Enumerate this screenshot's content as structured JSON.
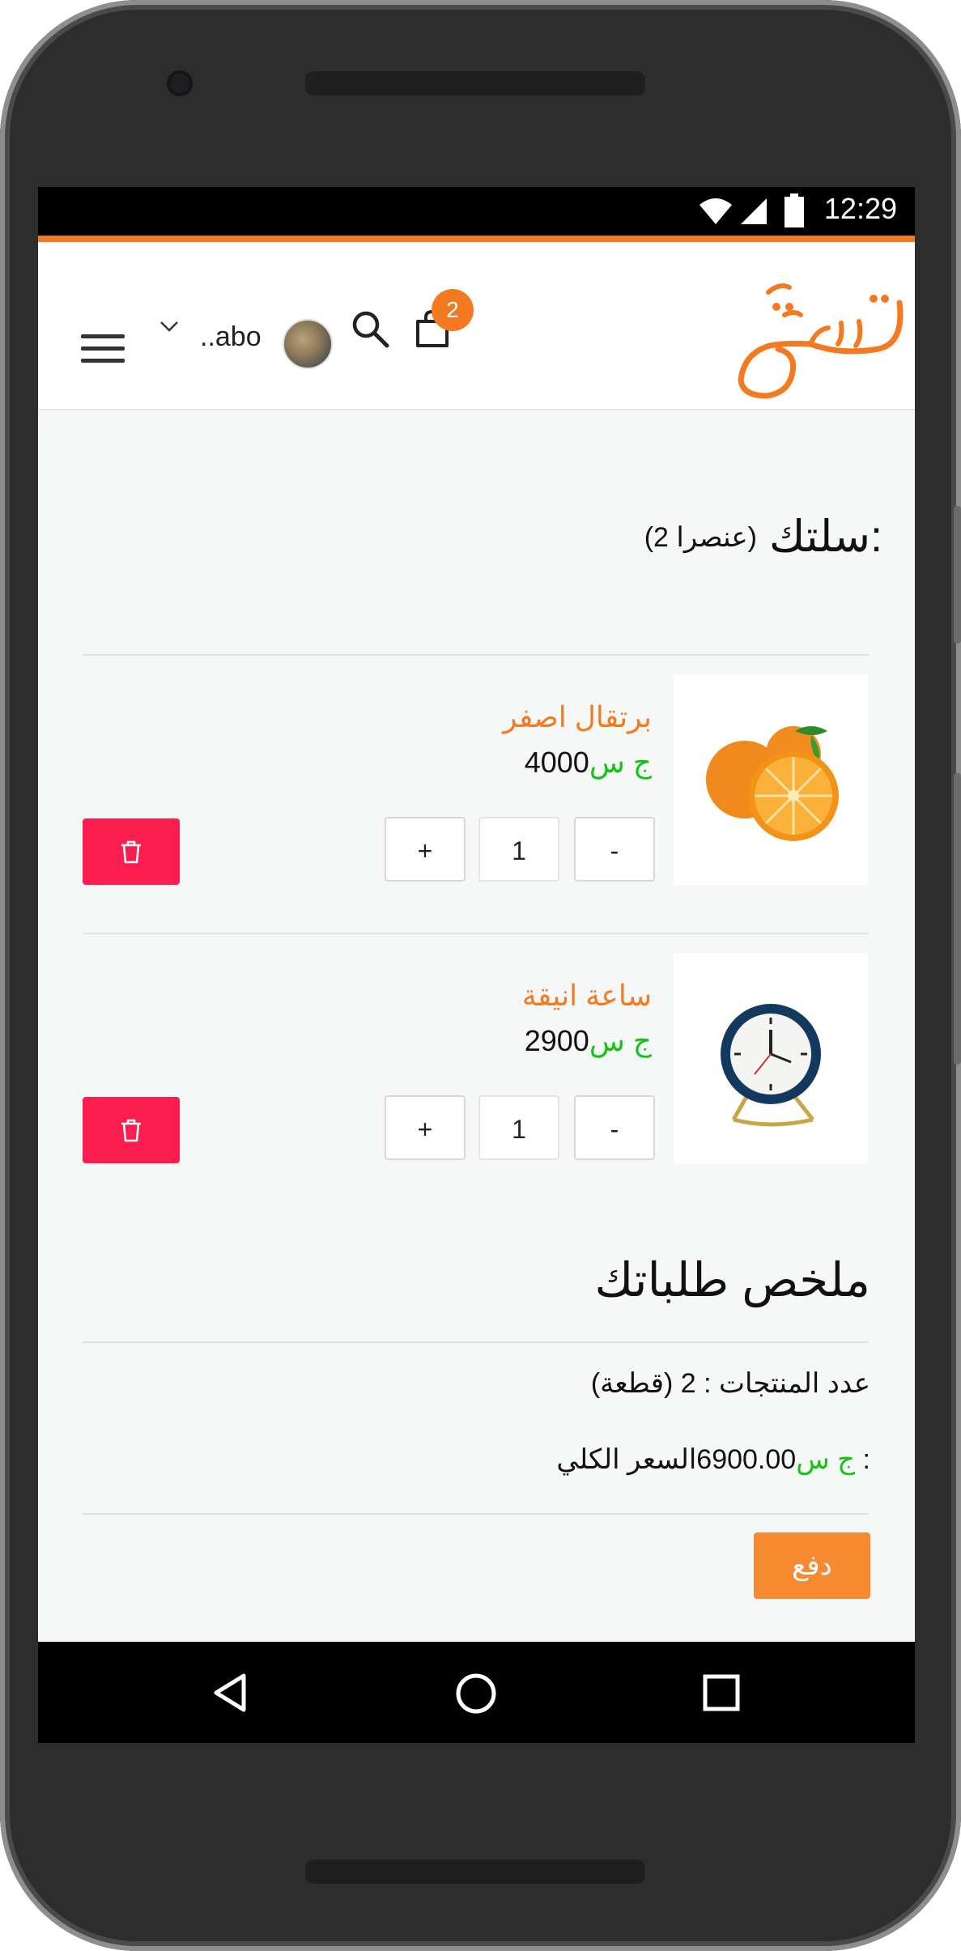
{
  "status_bar": {
    "time": "12:29"
  },
  "header": {
    "logo_text": "تسوق",
    "cart_badge": "2",
    "username": "..abo",
    "icons": [
      "menu-icon",
      "chevron-down-icon",
      "avatar",
      "search-icon",
      "shopping-bag-icon"
    ]
  },
  "cart": {
    "title": "سلتك:",
    "count_label": "(2 عنصرا)",
    "items": [
      {
        "name": "برتقال اصفر",
        "price": "4000",
        "currency": "ج س",
        "quantity": "1",
        "minus": "-",
        "plus": "+",
        "image": "oranges"
      },
      {
        "name": "ساعة انيقة",
        "price": "2900",
        "currency": "ج س",
        "quantity": "1",
        "minus": "-",
        "plus": "+",
        "image": "blue-clock"
      }
    ]
  },
  "summary": {
    "title": "ملخص طلباتك",
    "count_line": "عدد المنتجات : 2 (قطعة)",
    "total_label": "السعر الكلي : ",
    "total_value": "6900.00",
    "total_currency": "ج س",
    "pay_button": "دفع"
  },
  "colors": {
    "accent": "#f47a22",
    "delete": "#fb1d4e",
    "price_currency": "#17c117",
    "pay": "#f68a30"
  }
}
